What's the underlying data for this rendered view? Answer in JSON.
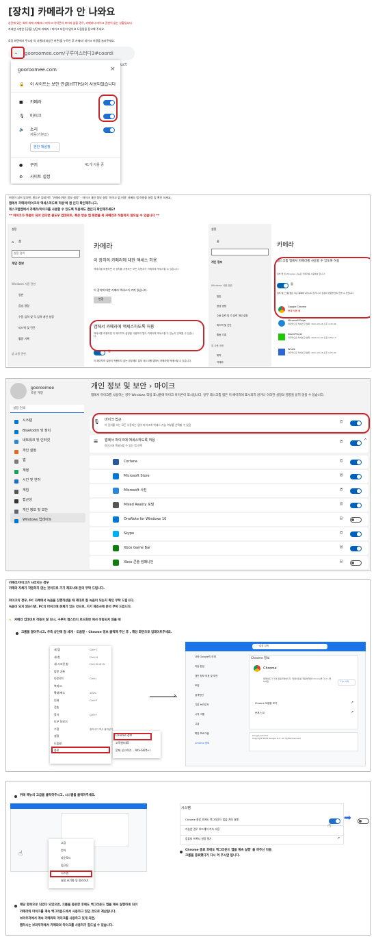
{
  "p1": {
    "title": "[장치] 카메라가 안 나와요",
    "l1": "상단에 있는 회의 바에 카메라나 마이크 아이콘이 보이지 않을 경우, 카메라나 마이크 권한이 없는 상황입니다.",
    "l2": "자세한 사항은 [공통] 상단에 카메라 / 마이크 버튼이 없어요 도움말을 참고해 주세요.",
    "l3": "로딩 화면에서 주소창 의 자물쇠(좌상단 버튼)을 누르신 후 카메라/ 마이크 허용을 눌러주세요.",
    "url": "gooroomee.com/구루미스터디3#coordi",
    "url_r": "uct",
    "site": "gooroomee.com",
    "secure": "이 사이트는 보안 연결(HTTPS)이 사용되었습니다",
    "camera": "카메라",
    "mic": "마이크",
    "sound": "소리",
    "sound_sub": "자동(기본값)",
    "reset": "권한 재설정",
    "cookie": "쿠키",
    "cookie_val": "41개 사용 중",
    "site_settings": "사이트 설정"
  },
  "p2": {
    "top": "허용이 되어 있다면, 윈도우 업데이트 \"카메라/개인 정보 설정\" - 마이크 개인 정보 설정 '마이크 앱 허용' 카메라 앱 허용을 설정 및 확인 하세요.",
    "l1": "앱에서 카메라/마이크의 액세스하도록 허용'에 켬 인지 확인해주시고,",
    "l2": "데스크탑앱에서 카메라/마이크를 사용할 수 있도록 허용에도 켬인지 확인해주세요!",
    "l3": "** 마이크가 허용이 되어 있다면 윈도우 업데이트, 혹은 방송 앱 화면을 꼭 카메라가 작동하지 않으실 수 있습니다 **",
    "nav_title": "설정",
    "home": "홈",
    "search": "설정 검색",
    "section": "개인 정보",
    "perm": "Windows 사용 권한",
    "n1": "일반",
    "n2": "음성 명령",
    "n3": "수동 입력 및 각 입력 개인 설정",
    "n4": "피드백 및 진단",
    "n5": "활동 기록",
    "n6": "앱 사용 권한",
    "n7": "위치",
    "n8": "카메라",
    "h": "카메라",
    "sub1": "이 장치의 카메라에 대한 액세스 허용",
    "desc1": "액세스를 허용하면 이 장치를 사용하는 모든 사용자가 카메라에 액세스할 수 있습니다.",
    "dev": "이 장치에 대한 카메라 액세스가 켜져 있습니다.",
    "change": "변경",
    "sub2": "앱에서 카메라에 액세스하도록 허용",
    "desc2": "액세스를 허용하면 이 페이지의 설정을 사용하여 앱이 카메라에 액세스할 수 있는지 선택할 수 있습니다.",
    "on": "켬",
    "note": "이 페이지의 설정이 적용되지 않는 경우에도 일부 데스크톱 앱에서 카메라에 액세스할 수 있습니다.",
    "note_link": "이유를 확인하세요",
    "r_h": "카메라",
    "r_sub": "데스크톱 앱에서 카메라를 사용할 수 있도록 허용",
    "r_desc": "일부 앱 및 Windows 기능은 카메라를 사용해야 합니다.",
    "r_on": "켬",
    "r_note": "일부 데스크톱 앱은 이곳 목록에 나타나지 않거나 이 설정의 영향을 받지 않을 수 있습니다.",
    "r_link": "이유를 확인하세요",
    "apps": [
      {
        "n": "Google Chrome",
        "d": "현재 사용 중"
      },
      {
        "n": "Microsoft Edge",
        "d": "마지막으로 액세스한 날짜: 2021-03-26 오후 2:43:46"
      },
      {
        "n": "NaverPlayer",
        "d": "마지막으로 액세스한 날짜: 2020-12-04 오전 9:56:13"
      },
      {
        "n": "Whale",
        "d": "마지막으로 액세스한 날짜: 2021-03-26 오후 2:25:44"
      }
    ],
    "l_apps": [
      "위치",
      "카메라"
    ]
  },
  "p3": {
    "user": "gooroomee",
    "user_sub": "로컬 계정",
    "search": "설정 검색",
    "crumb": "개인 정보 및 보안  ›  마이크",
    "desc": "앱에서 마이크를 사용하는 경우 Windows 작업 표시줄에 마이크 아이콘이 표시됩니다. 일부 데스크톱 앱은 이 페이지에 표시되지 않거나 이러한 설정의 영향을 받지 않을 수 있습니다.",
    "desc_link": "자세한 정보",
    "access": "마이크 접근",
    "access_sub": "이 장치를 쓰는 모든 사용자는 앱이 마이크에 액세스 가능 여부를 선택할 수 있음",
    "on": "켬",
    "off": "끔",
    "apps_h": "앱에서 마이크에 액세스하도록 허용",
    "apps_sub": "마이크에 액세스할 수 있는 앱 선택",
    "nav": [
      "시스템",
      "Bluetooth 및 장치",
      "네트워크 및 인터넷",
      "개인 설정",
      "앱",
      "계정",
      "시간 및 언어",
      "게임",
      "접근성",
      "개인 정보 및 보안",
      "Windows 업데이트"
    ],
    "list": [
      "Cortana",
      "Microsoft Store",
      "Microsoft 사진",
      "Mixed Reality 포털",
      "OneNote for Windows 10",
      "Skype",
      "Xbox Game Bar",
      "Xbox 콘솔 컴패니언"
    ]
  },
  "p4": {
    "t0": "카메라/마이크가 사라지는 경우",
    "l1": "카메라 자체가 작동하지 않는 것이므로 기기 제조사에 문의 부탁 드립니다.",
    "l2": "마이크의 경우, PC 자체에서 녹음을 진행하셨을 때 제대로 잘 녹음이 되는지 확인 부탁 드립니다.",
    "l3": "녹음이 되지 않는다면, PC의 마이크에 문제가 있는 것으로, 기기 제조사에 문의 부탁 드립니다.",
    "l4": "카메라 업데이트 작동이 잘 되나, 구루미 캠스터디 로드화면 에서 작동되지 않을 때",
    "l5": "크롬을 열어주시고, 우측 상단에 점 세개 - 도움말 - Chrome 정보 클릭해 주신 후 , 해당 화면으로 업데이트주세요.",
    "menu": [
      "새 탭",
      "새 창",
      "새 시크릿 창",
      "방문 기록",
      "다운로드",
      "북마크",
      "확대/축소",
      "인쇄",
      "전송",
      "찾기",
      "도구 더보기",
      "수정",
      "설정",
      "도움말",
      "종료"
    ],
    "menu_sc": [
      "Ctrl+T",
      "Ctrl+N",
      "Ctrl+Shift+N",
      "",
      "Ctrl+J",
      "",
      "100%",
      "Ctrl+P",
      "",
      "Ctrl+F",
      "",
      "잘라내기  복사  붙여넣기",
      "",
      "",
      ""
    ],
    "sub": [
      "Chrome 정보",
      "고객센터(E)",
      "문제 신고하기...     Alt+Shift+I"
    ],
    "c_search": "설정 검색",
    "c_nav": [
      "나와 Google의 관계",
      "자동 완성",
      "개인 정보 보호 및 보안",
      "모양",
      "검색엔진",
      "기본 브라우저",
      "시작 그룹",
      "고급",
      "확장 프로그램",
      "Chrome 정보"
    ],
    "c_title": "Chrome 정보",
    "c_app": "Chrome",
    "c_desc": "업데이트가 거의 완료되었습니다. 업데이트를 적용하려면 Chrome을 다시 시작하세요.",
    "c_relaunch": "다시 시작",
    "c_help": "Chrome 도움말 보기",
    "c_report": "문제 신고",
    "c_copy": "Google Chrome\nCopyright 2021 Google LLC. All rights reserved."
  },
  "p5": {
    "b1": "위에 메뉴의 고급을 클릭하주시고, 시스템을 클릭하주세요.",
    "sys": "시스템",
    "o1": "Chrome 종료 후에도 백그라운드 앱을 계속 실행",
    "o2": "가능한 경우 하드웨어 가속 사용",
    "o3": "컴퓨터 프록시 설정 열기",
    "b2": "Chrome 종료 후에도 백그라운드 앱을 계속 실행' 을 꺼주신 다음",
    "b2b": "크롬을 종료했다가 다시 켜 주시면 됩니다.",
    "m": [
      "고급",
      "언어",
      "다운로드",
      "접근성",
      "시스템",
      "설정 초기화 및 정리하기"
    ],
    "b3": "해당 항목으로 되었다 되었으면, 크롬을 종료한 후에도 백그라운드 앱을 계속 실행하게 되어",
    "b3b": "카메라와 마이크를 계속 백그라운드에서 사용하고 있던 것으로 계산됩니다.",
    "b3c": "브라우저에서 계속 카메라와 마이크를 사용하고 있게 되면,",
    "b3d": "캠하시는 브라우저에서 카메라와 마이크를 사용하기 힘드실 수 있습니다."
  },
  "colors": {
    "accent": "#1f6fd1",
    "red": "#c8242a",
    "win_sel": "#e5e5e5"
  }
}
